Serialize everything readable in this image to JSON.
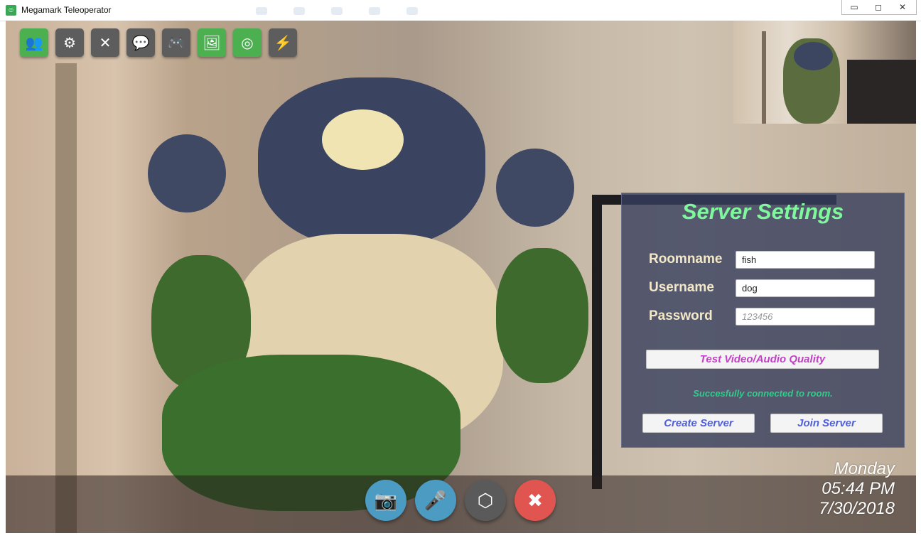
{
  "window": {
    "title": "Megamark Teleoperator",
    "controls": {
      "minimize": "▭",
      "maximize": "◻",
      "close": "✕"
    }
  },
  "toolbar": [
    {
      "name": "users-icon",
      "glyph": "👥",
      "color": "#4caf50"
    },
    {
      "name": "gear-icon",
      "glyph": "⚙",
      "color": "#5d5d5d"
    },
    {
      "name": "tools-icon",
      "glyph": "✕",
      "color": "#5d5d5d"
    },
    {
      "name": "chat-icon",
      "glyph": "💬",
      "color": "#5d5d5d"
    },
    {
      "name": "gamepad-icon",
      "glyph": "🎮",
      "color": "#5d5d5d"
    },
    {
      "name": "image-icon",
      "glyph": "🖼",
      "color": "#4caf50"
    },
    {
      "name": "compass-icon",
      "glyph": "◎",
      "color": "#4caf50"
    },
    {
      "name": "bolt-icon",
      "glyph": "⚡",
      "color": "#5d5d5d"
    }
  ],
  "server_settings": {
    "title": "Server Settings",
    "roomname": {
      "label": "Roomname",
      "value": "fish"
    },
    "username": {
      "label": "Username",
      "value": "dog"
    },
    "password": {
      "label": "Password",
      "placeholder": "123456"
    },
    "test_button": "Test Video/Audio Quality",
    "status": "Succesfully connected to room.",
    "create_button": "Create Server",
    "join_button": "Join Server"
  },
  "datetime": {
    "day": "Monday",
    "time": "05:44 PM",
    "date": "7/30/2018"
  },
  "bottom_controls": [
    {
      "name": "camera-icon",
      "glyph": "📷",
      "color": "#4b9bc2"
    },
    {
      "name": "microphone-icon",
      "glyph": "🎤",
      "color": "#4b9bc2"
    },
    {
      "name": "cube-icon",
      "glyph": "⬡",
      "color": "#5a5a5a"
    },
    {
      "name": "close-icon",
      "glyph": "✖",
      "color": "#e0554f"
    }
  ],
  "colors": {
    "title_green": "#7ff79d",
    "status_green": "#33c98b",
    "test_button_text": "#c340c6",
    "server_button_text": "#4f5fd8"
  }
}
